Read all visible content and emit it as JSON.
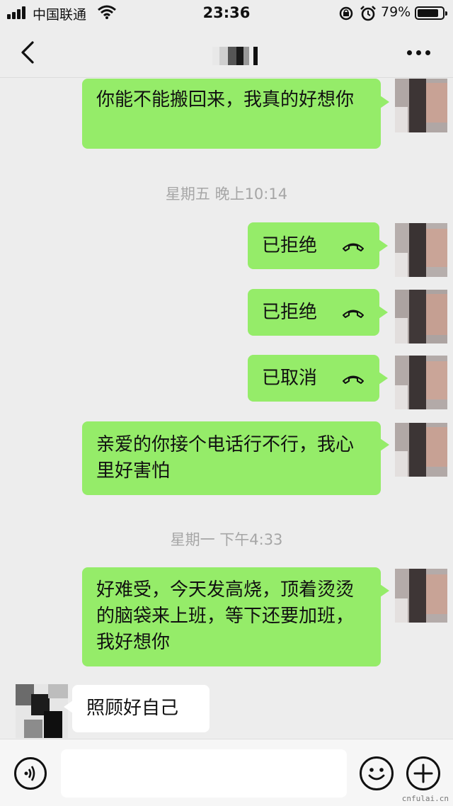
{
  "status_bar": {
    "carrier": "中国联通",
    "time": "23:36",
    "battery_percent": "79%",
    "icons": [
      "signal-icon",
      "wifi-icon",
      "orientation-lock-icon",
      "alarm-icon",
      "battery-icon"
    ]
  },
  "nav": {
    "back_icon": "chevron-left-icon",
    "title": "",
    "more_icon": "more-dots-icon"
  },
  "messages": [
    {
      "type": "text",
      "direction": "out",
      "text": "你能不能搬回来，我真的好想你"
    },
    {
      "type": "timestamp",
      "text": "星期五 晚上10:14"
    },
    {
      "type": "call",
      "direction": "out",
      "text": "已拒绝",
      "icon": "hangup-phone-icon"
    },
    {
      "type": "call",
      "direction": "out",
      "text": "已拒绝",
      "icon": "hangup-phone-icon"
    },
    {
      "type": "call",
      "direction": "out",
      "text": "已取消",
      "icon": "hangup-phone-icon"
    },
    {
      "type": "text",
      "direction": "out",
      "text": "亲爱的你接个电话行不行，我心里好害怕"
    },
    {
      "type": "timestamp",
      "text": "星期一 下午4:33"
    },
    {
      "type": "text",
      "direction": "out",
      "text": "好难受，今天发高烧，顶着烫烫的脑袋来上班，等下还要加班，我好想你"
    },
    {
      "type": "text",
      "direction": "in",
      "text": "照顾好自己"
    }
  ],
  "input_bar": {
    "voice_icon": "voice-icon",
    "text_value": "",
    "emoji_icon": "emoji-icon",
    "plus_icon": "plus-icon"
  },
  "watermark": "cnfulai.cn",
  "colors": {
    "background": "#ededed",
    "outgoing_bubble": "#95ec69",
    "incoming_bubble": "#ffffff",
    "timestamp": "#a6a6a6"
  }
}
